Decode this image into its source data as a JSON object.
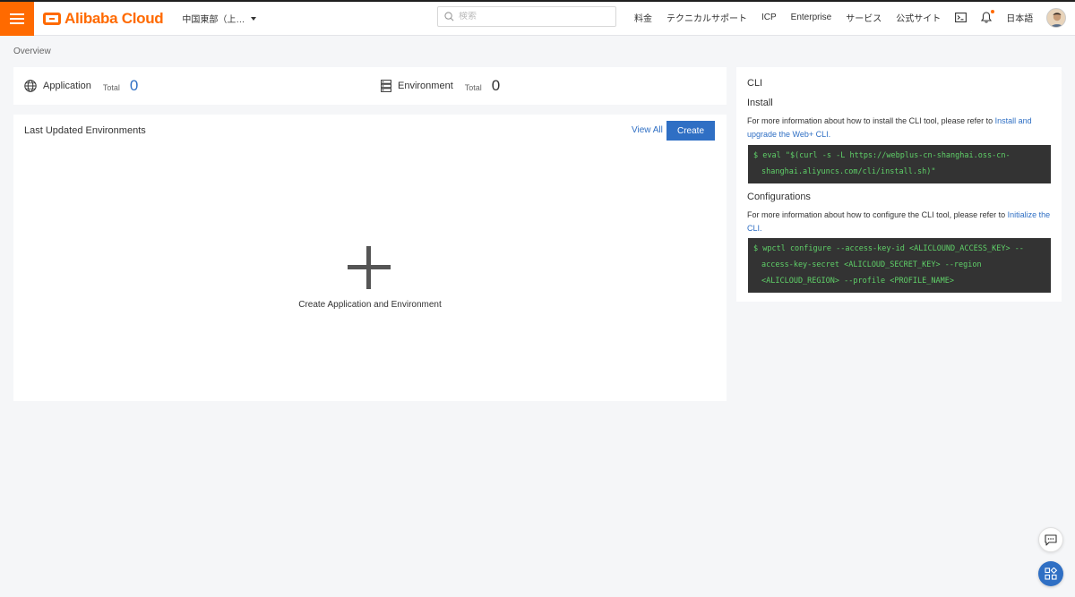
{
  "header": {
    "logo_text": "Alibaba Cloud",
    "region": "中国東部（上…",
    "search_placeholder": "検索",
    "nav_items": [
      "料金",
      "テクニカルサポート",
      "ICP",
      "Enterprise",
      "サービス",
      "公式サイト"
    ],
    "language": "日本語",
    "icons": [
      "menu-icon",
      "terminal-icon",
      "bell-icon",
      "search-icon",
      "avatar"
    ],
    "brand_color": "#ff6a00"
  },
  "breadcrumb": "Overview",
  "stats": {
    "application": {
      "label": "Application",
      "total_label": "Total",
      "count": "0"
    },
    "environment": {
      "label": "Environment",
      "total_label": "Total",
      "count": "0"
    }
  },
  "environments_panel": {
    "title": "Last Updated Environments",
    "view_all": "View All",
    "create": "Create",
    "empty_label": "Create Application and Environment"
  },
  "cli": {
    "title": "CLI",
    "install": {
      "heading": "Install",
      "text": "For more information about how to install the CLI tool, please refer to ",
      "link": "Install and upgrade the Web+ CLI.",
      "code_line1": "$ eval \"$(curl -s -L https://webplus-cn-shanghai.oss-cn-",
      "code_line2": "shanghai.aliyuncs.com/cli/install.sh)\""
    },
    "configurations": {
      "heading": "Configurations",
      "text": "For more information about how to configure the CLI tool, please refer to ",
      "link": "Initialize the CLI.",
      "code_line1": "$ wpctl configure --access-key-id <ALICLOUND_ACCESS_KEY> --",
      "code_line2": "access-key-secret <ALICLOUD_SECRET_KEY> --region",
      "code_line3": "<ALICLOUD_REGION> --profile <PROFILE_NAME>"
    }
  },
  "colors": {
    "accent": "#2f6fc4",
    "code_bg": "#333333",
    "code_text": "#5fd068"
  }
}
